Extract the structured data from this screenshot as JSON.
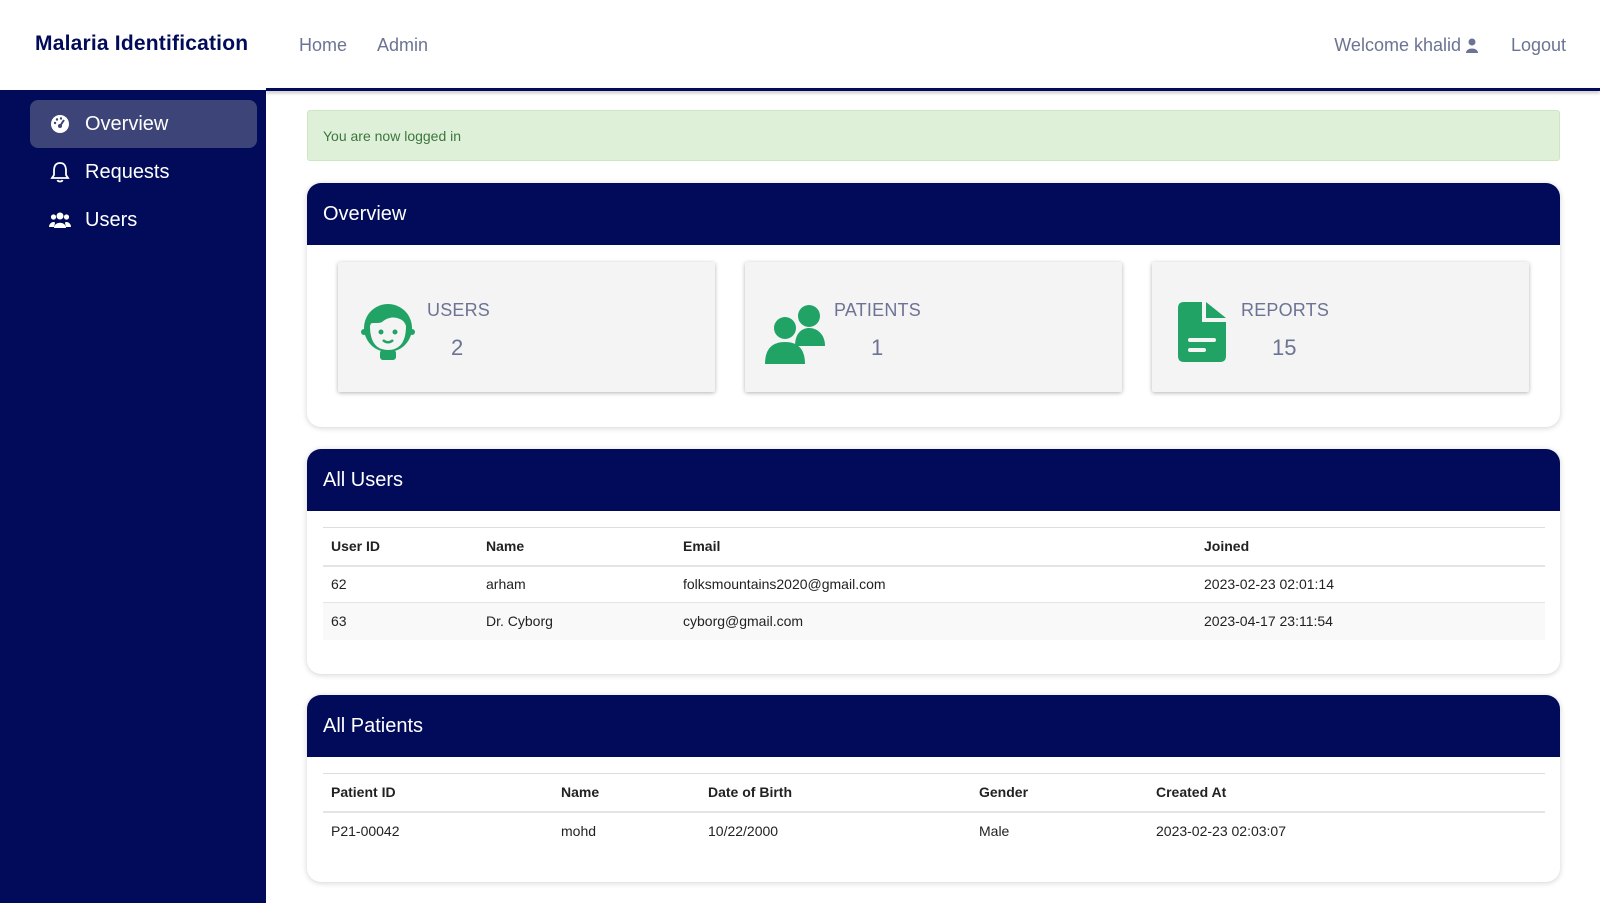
{
  "header": {
    "brand": "Malaria Identification",
    "nav": [
      {
        "label": "Home"
      },
      {
        "label": "Admin"
      }
    ],
    "welcome": "Welcome khalid",
    "logout": "Logout"
  },
  "sidebar": {
    "items": [
      {
        "label": "Overview",
        "icon": "dashboard-gauge-icon",
        "active": true
      },
      {
        "label": "Requests",
        "icon": "bell-icon"
      },
      {
        "label": "Users",
        "icon": "users-icon"
      }
    ]
  },
  "alert": {
    "text": "You are now logged in"
  },
  "overview": {
    "title": "Overview",
    "stats": [
      {
        "label": "USERS",
        "value": "2",
        "icon": "user-face-icon"
      },
      {
        "label": "PATIENTS",
        "value": "1",
        "icon": "people-icon"
      },
      {
        "label": "REPORTS",
        "value": "15",
        "icon": "document-icon"
      }
    ],
    "icon_color": "#21a366"
  },
  "users": {
    "title": "All Users",
    "columns": [
      "User ID",
      "Name",
      "Email",
      "Joined"
    ],
    "rows": [
      [
        "62",
        "arham",
        "folksmountains2020@gmail.com",
        "2023-02-23 02:01:14"
      ],
      [
        "63",
        "Dr. Cyborg",
        "cyborg@gmail.com",
        "2023-04-17 23:11:54"
      ]
    ]
  },
  "patients": {
    "title": "All Patients",
    "columns": [
      "Patient ID",
      "Name",
      "Date of Birth",
      "Gender",
      "Created At"
    ],
    "rows": [
      [
        "P21-00042",
        "mohd",
        "10/22/2000",
        "Male",
        "2023-02-23 02:03:07"
      ]
    ]
  },
  "colors": {
    "primary": "#020b5a",
    "sidebar_active": "#3d4478",
    "alert_bg": "#dff0d8",
    "alert_text": "#3c763d"
  }
}
